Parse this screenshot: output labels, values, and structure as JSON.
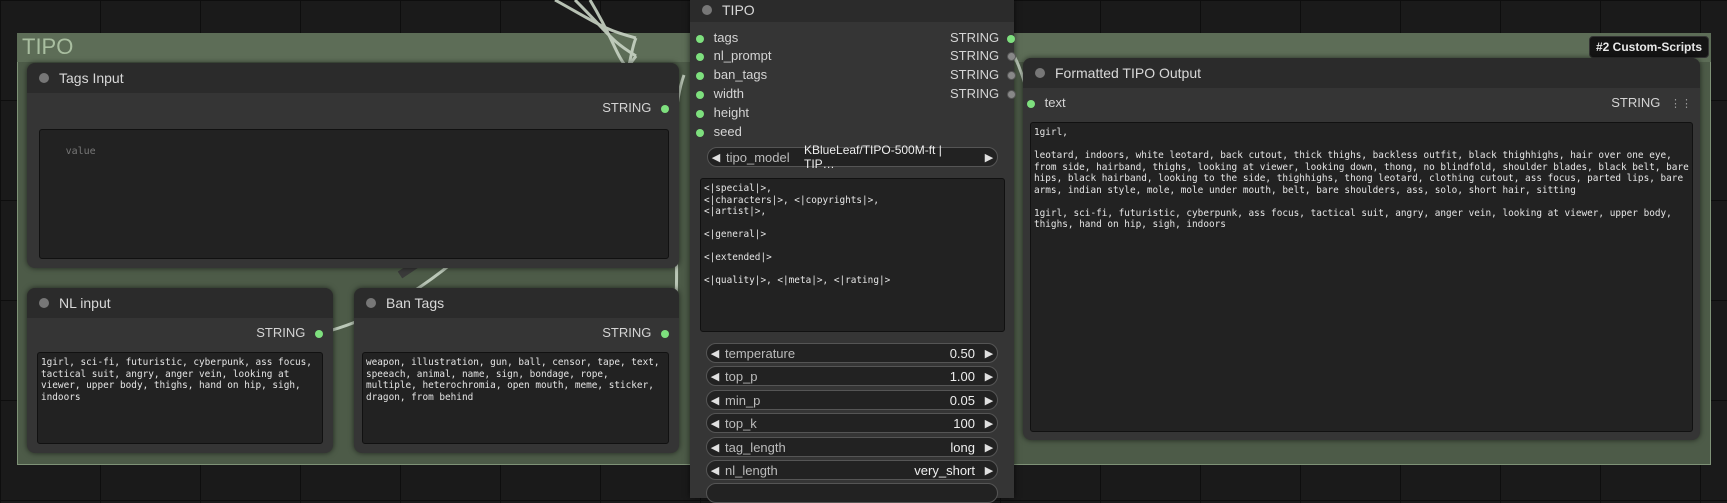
{
  "group": {
    "title": "TIPO",
    "badge": "#2 Custom-Scripts"
  },
  "tipo_node": {
    "title": "TIPO",
    "inputs": [
      "tags",
      "nl_prompt",
      "ban_tags",
      "width",
      "height",
      "seed"
    ],
    "outputs": [
      "STRING",
      "STRING",
      "STRING",
      "STRING"
    ],
    "model_label": "tipo_model",
    "model_value": "KBlueLeaf/TIPO-500M-ft | TIP…",
    "format_text": "<|special|>,\n<|characters|>, <|copyrights|>,\n<|artist|>,\n\n<|general|>\n\n<|extended|>\n\n<|quality|>, <|meta|>, <|rating|>",
    "widgets": [
      {
        "label": "temperature",
        "value": "0.50"
      },
      {
        "label": "top_p",
        "value": "1.00"
      },
      {
        "label": "min_p",
        "value": "0.05"
      },
      {
        "label": "top_k",
        "value": "100"
      },
      {
        "label": "tag_length",
        "value": "long"
      },
      {
        "label": "nl_length",
        "value": "very_short"
      }
    ]
  },
  "tags_input": {
    "title": "Tags Input",
    "output": "STRING",
    "placeholder": "value"
  },
  "nl_input": {
    "title": "NL input",
    "output": "STRING",
    "text": "1girl, sci-fi, futuristic, cyberpunk, ass focus, tactical suit, angry, anger vein, looking at viewer, upper body, thighs, hand on hip, sigh, indoors"
  },
  "ban_tags": {
    "title": "Ban Tags",
    "output": "STRING",
    "text": "weapon, illustration, gun, ball, censor, tape, text, speeach, animal, name, sign, bondage, rope, multiple, heterochromia, open mouth, meme, sticker, dragon, from behind"
  },
  "formatted_output": {
    "title": "Formatted TIPO Output",
    "input": "text",
    "output": "STRING",
    "text": "1girl,\n\nleotard, indoors, white leotard, back cutout, thick thighs, backless outfit, black thighhighs, hair over one eye, from side, hairband, thighs, looking at viewer, looking down, thong, no blindfold, shoulder blades, black belt, bare hips, black hairband, looking to the side, thighhighs, thong leotard, clothing cutout, ass focus, parted lips, bare arms, indian style, mole, mole under mouth, belt, bare shoulders, ass, solo, short hair, sitting\n\n1girl, sci-fi, futuristic, cyberpunk, ass focus, tactical suit, angry, anger vein, looking at viewer, upper body, thighs, hand on hip, sigh, indoors"
  },
  "colors": {
    "group_bg": "#4d5b48",
    "node_bg": "#353535",
    "slot_on": "#7ee07e",
    "wire": "#c8d4c4"
  }
}
